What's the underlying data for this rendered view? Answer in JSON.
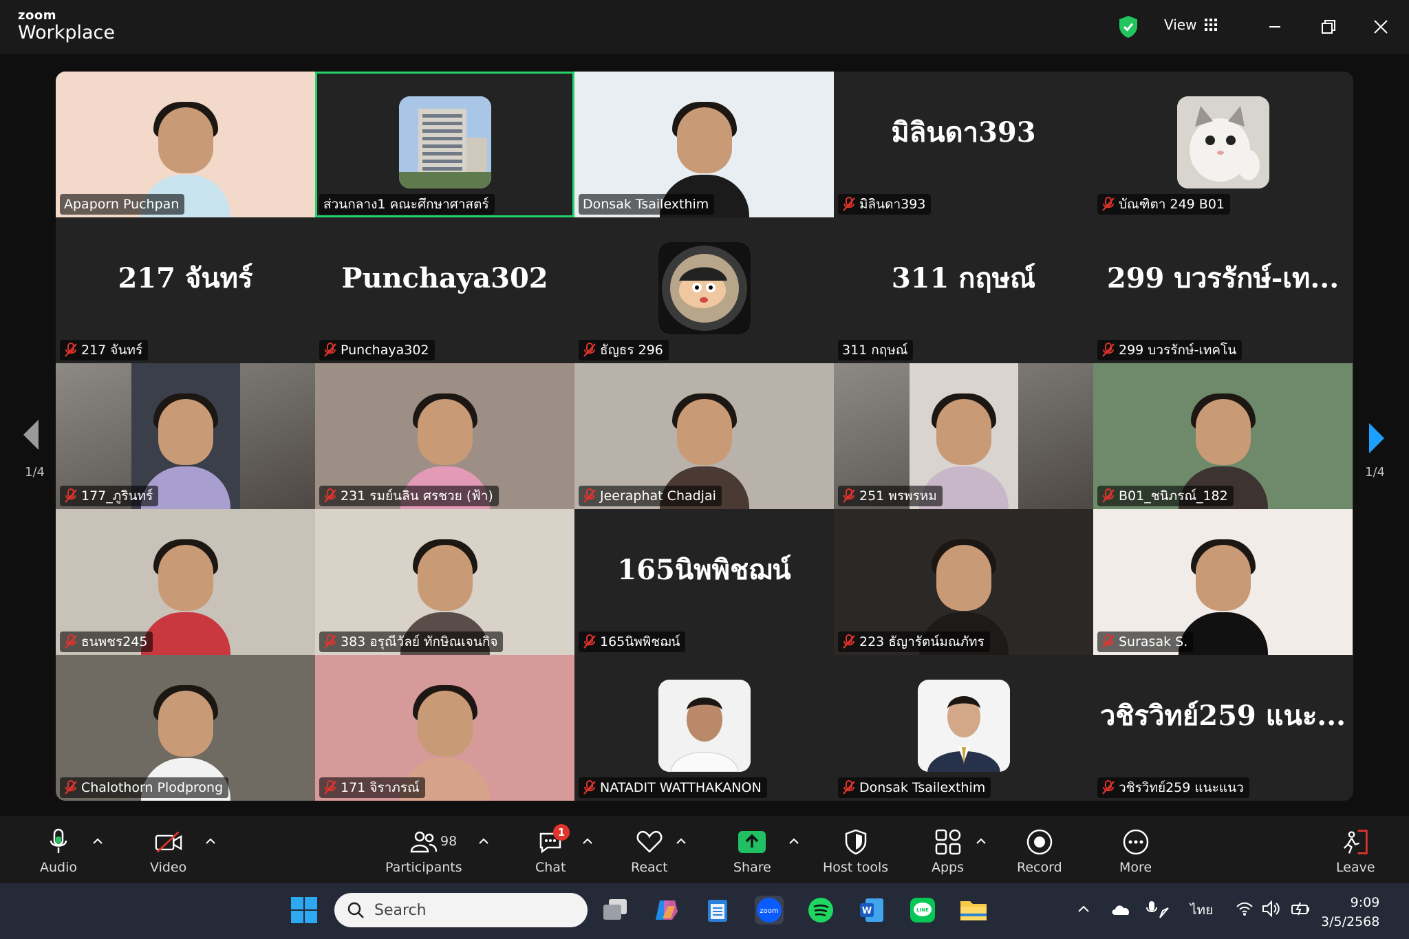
{
  "app": {
    "brand_small": "zoom",
    "brand_large": "Workplace",
    "view_label": "View"
  },
  "tiles": [
    {
      "name": "Apaporn Puchpan",
      "kind": "video",
      "muted": false,
      "bg": "#f3d9c9",
      "shirt": "#c9e3ef"
    },
    {
      "name": "ส่วนกลาง1 คณะศึกษาศาสตร์",
      "kind": "avatar",
      "muted": false,
      "active": true,
      "avatar": "building"
    },
    {
      "name": "Donsak Tsailexthim",
      "kind": "video",
      "muted": false,
      "bg": "#e8eef2",
      "shirt": "#1b1b1b"
    },
    {
      "name": "มิลินดา393",
      "kind": "text",
      "big": "มิลินดา393",
      "muted": true
    },
    {
      "name": "บัณฑิตา 249 B01",
      "kind": "avatar",
      "muted": true,
      "avatar": "cat"
    },
    {
      "name": "217 จันทร์",
      "kind": "text",
      "big": "217 จันทร์",
      "muted": true
    },
    {
      "name": "Punchaya302",
      "kind": "text",
      "big": "Punchaya302",
      "muted": true
    },
    {
      "name": "ธัญธร 296",
      "kind": "avatar",
      "muted": true,
      "avatar": "cartoon"
    },
    {
      "name": "311 กฤษณ์",
      "kind": "text",
      "big": "311 กฤษณ์",
      "muted": false
    },
    {
      "name": "299 บวรรักษ์-เทคโน",
      "kind": "text",
      "big": "299 บวรรักษ์-เท...",
      "muted": true
    },
    {
      "name": "177_ภูรินทร์",
      "kind": "video-narrow",
      "muted": true,
      "bg": "#3a3f4a",
      "shirt": "#a89fd0"
    },
    {
      "name": "231 รมย์นลิน ศรชวย (ฟ้า)",
      "kind": "video",
      "muted": true,
      "bg": "#9e8f86",
      "shirt": "#e39ab7"
    },
    {
      "name": "Jeeraphat Chadjai",
      "kind": "video",
      "muted": true,
      "bg": "#b8b2ab",
      "shirt": "#4a3a33"
    },
    {
      "name": "251 พรพรหม",
      "kind": "video-narrow",
      "muted": true,
      "bg": "#d9d4cf",
      "shirt": "#c8b7c8"
    },
    {
      "name": "B01_ชนิภรณ์_182",
      "kind": "video",
      "muted": true,
      "bg": "#6e8a6a",
      "shirt": "#3d3330"
    },
    {
      "name": "ธนพชร245",
      "kind": "video",
      "muted": true,
      "bg": "#c9c2b8",
      "shirt": "#c8383e"
    },
    {
      "name": "383 อรุณีวัลย์ ทักษิณเจนกิจ",
      "kind": "video",
      "muted": true,
      "bg": "#d8d2c8",
      "shirt": "#5a4c48"
    },
    {
      "name": "165นิพพิชฌน์",
      "kind": "text",
      "big": "165นิพพิชฌน์",
      "muted": true
    },
    {
      "name": "223 ธัญารัตน์มณภัทร",
      "kind": "video",
      "muted": true,
      "bg": "#2c2826",
      "shirt": "#1e1a18"
    },
    {
      "name": "Surasak S.",
      "kind": "video",
      "muted": true,
      "bg": "#f1ece8",
      "shirt": "#111111"
    },
    {
      "name": "Chalothorn Plodprong",
      "kind": "video",
      "muted": true,
      "bg": "#6f6a62",
      "shirt": "#f2f2f2"
    },
    {
      "name": "171 จิราภรณ์",
      "kind": "video",
      "muted": true,
      "bg": "#d69a9a",
      "shirt": "#d7a28a"
    },
    {
      "name": "NATADIT WATTHAKANON",
      "kind": "avatar",
      "muted": true,
      "avatar": "portrait"
    },
    {
      "name": "Donsak Tsailexthim",
      "kind": "avatar",
      "muted": true,
      "avatar": "portrait-suit"
    },
    {
      "name": "วชิรวิทย์259 แนะแนว",
      "kind": "text",
      "big": "วชิรวิทย์259 แนะ...",
      "muted": true
    }
  ],
  "pager": {
    "left": "1/4",
    "right": "1/4"
  },
  "toolbar": {
    "audio": "Audio",
    "video": "Video",
    "participants": "Participants",
    "participants_count": "98",
    "chat": "Chat",
    "chat_badge": "1",
    "react": "React",
    "share": "Share",
    "host_tools": "Host tools",
    "apps": "Apps",
    "record": "Record",
    "more": "More",
    "leave": "Leave"
  },
  "taskbar": {
    "search_placeholder": "Search",
    "language": "ไทย",
    "time": "9:09",
    "date": "3/5/2568"
  },
  "colors": {
    "active_speaker": "#22d46e",
    "muted_mic": "#e0342c",
    "share": "#21c062",
    "leave": "#e0342c"
  }
}
